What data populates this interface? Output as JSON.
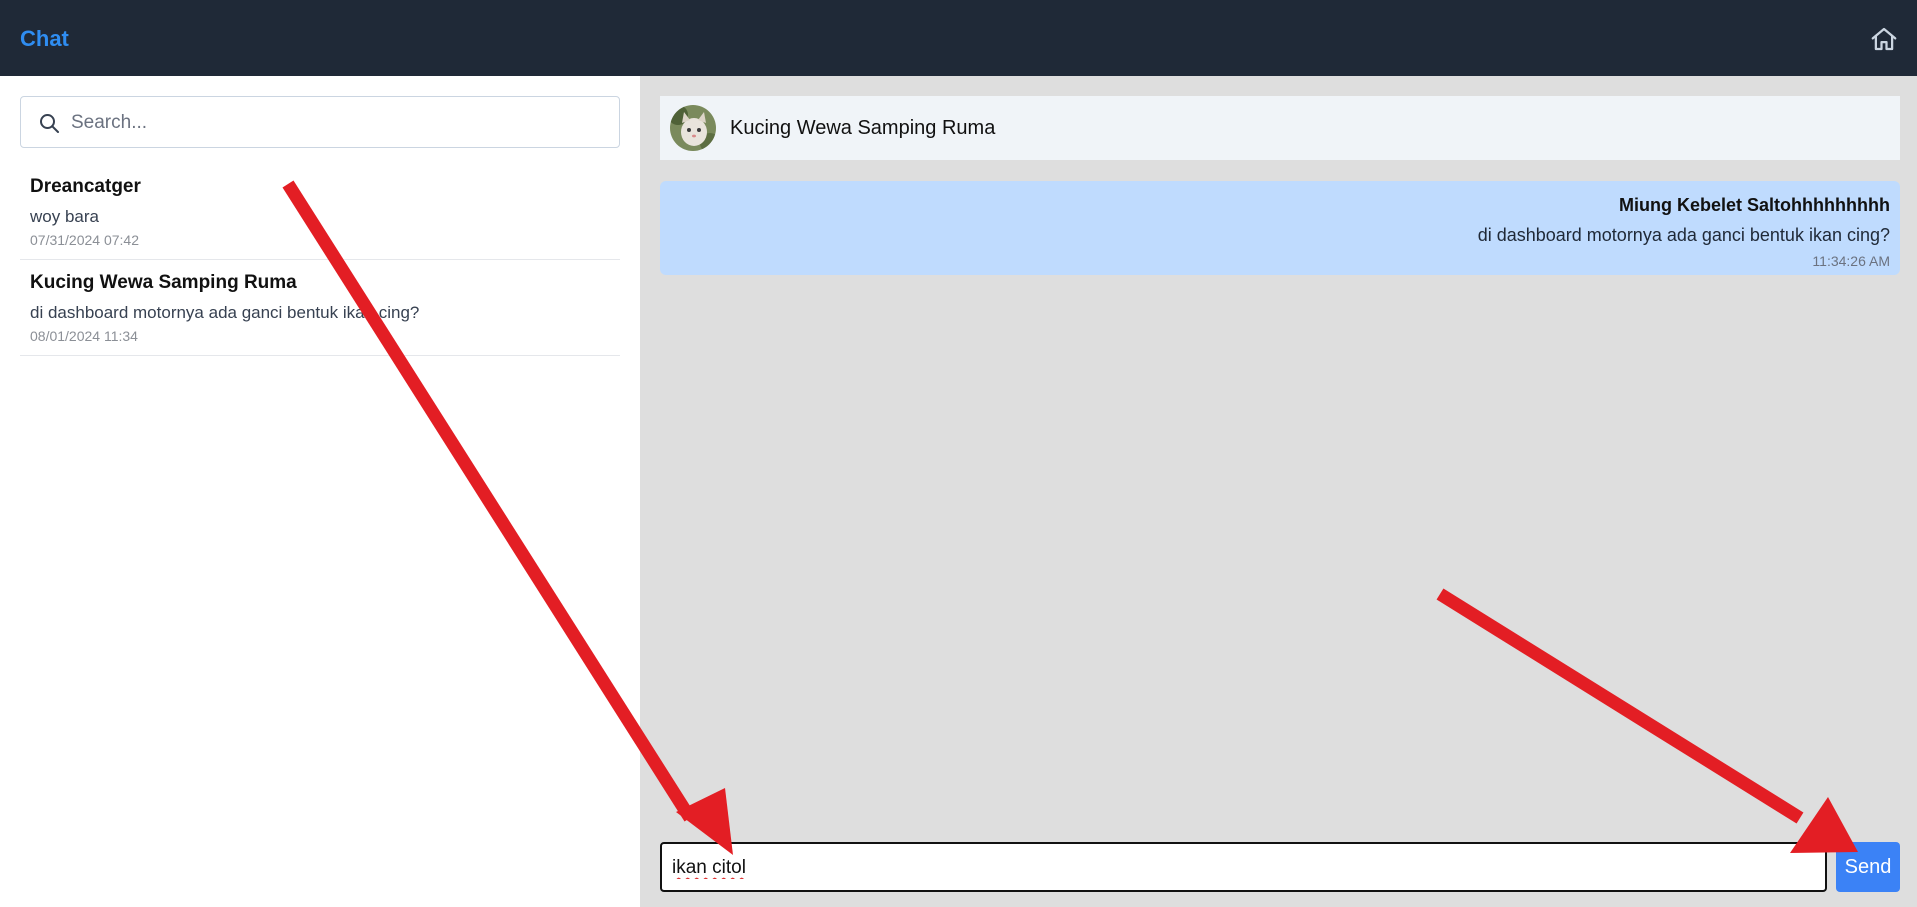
{
  "header": {
    "title": "Chat",
    "home_icon": "home-icon"
  },
  "sidebar": {
    "search": {
      "placeholder": "Search..."
    },
    "conversations": [
      {
        "name": "Dreancatger",
        "preview": "woy bara",
        "time": "07/31/2024 07:42"
      },
      {
        "name": "Kucing Wewa Samping Ruma",
        "preview": "di dashboard motornya ada ganci bentuk ikan cing?",
        "time": "08/01/2024 11:34"
      }
    ]
  },
  "chat": {
    "contact_name": "Kucing Wewa Samping Ruma",
    "messages": [
      {
        "sender": "Miung Kebelet Saltohhhhhhhhh",
        "text": "di dashboard motornya ada ganci bentuk ikan cing?",
        "time": "11:34:26 AM"
      }
    ],
    "composer": {
      "value": "ikan citol"
    },
    "send_label": "Send"
  },
  "colors": {
    "topbar": "#1f2937",
    "brand": "#2f8df1",
    "chat_bg": "#dedede",
    "bubble": "#bfdbfe",
    "send_button": "#3b82f6",
    "annotation_arrow": "#e31e24"
  }
}
